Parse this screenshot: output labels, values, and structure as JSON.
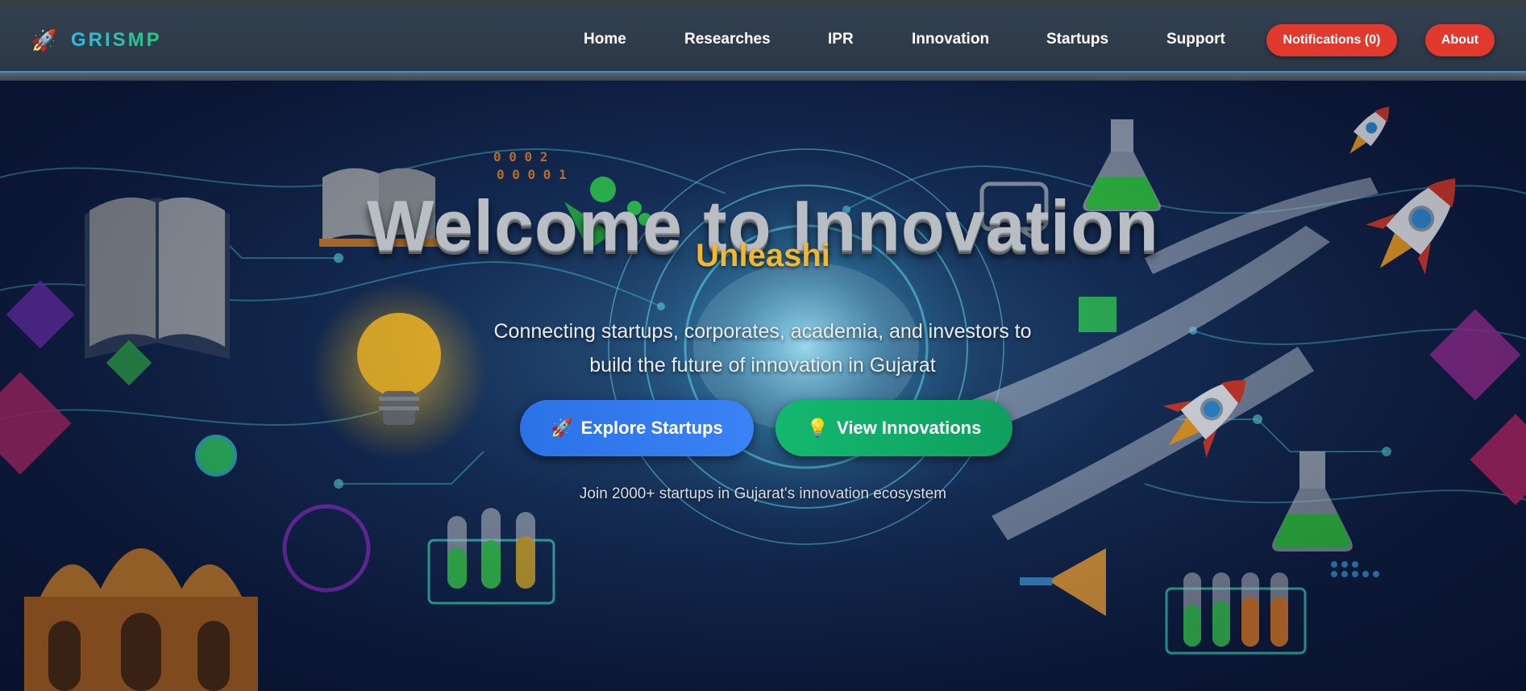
{
  "brand": {
    "name": "GRISMP",
    "icon": "rocket-icon"
  },
  "nav": {
    "links": [
      "Home",
      "Researches",
      "IPR",
      "Innovation",
      "Startups",
      "Support"
    ],
    "notifications_label": "Notifications (0)",
    "about_label": "About"
  },
  "hero": {
    "title": "Welcome to Innovation",
    "subtitle": "Unleashi",
    "description": "Connecting startups, corporates, academia, and investors to build the future of innovation in Gujarat",
    "buttons": [
      {
        "icon": "rocket-icon",
        "label": "Explore Startups"
      },
      {
        "icon": "lightbulb-icon",
        "label": "View Innovations"
      }
    ],
    "join_text": "Join 2000+ startups in Gujarat's innovation ecosystem"
  },
  "colors": {
    "accent_red": "#e03a2e",
    "cta_blue": "#3b82f6",
    "cta_green": "#10b068",
    "subtitle_gold": "#f0b830",
    "navbar_bg": "#2f3b4a"
  }
}
